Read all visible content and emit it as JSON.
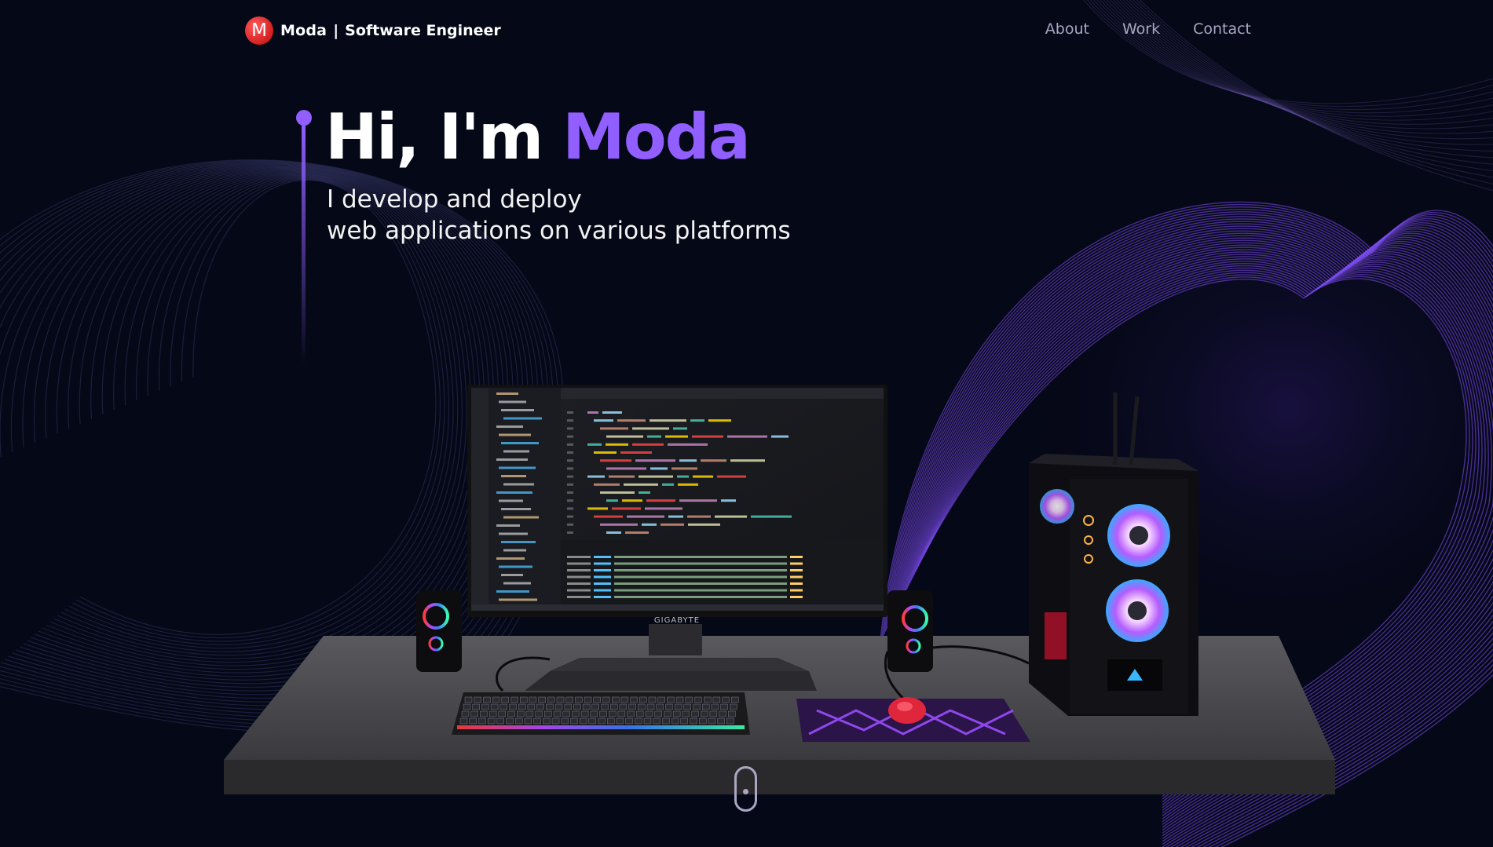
{
  "navbar": {
    "logo_letter": "M",
    "brand_name": "Moda",
    "brand_separator": "|",
    "brand_role": "Software Engineer",
    "links": [
      {
        "label": "About"
      },
      {
        "label": "Work"
      },
      {
        "label": "Contact"
      }
    ]
  },
  "hero": {
    "greeting": "Hi, I'm ",
    "name": "Moda",
    "subtitle_line1": "I develop and deploy",
    "subtitle_line2": "web applications on various platforms"
  },
  "scene": {
    "monitor_brand": "GIGABYTE"
  },
  "colors": {
    "background": "#050816",
    "accent": "#915eff",
    "nav_text": "#aaa6c3",
    "logo": "#d21f1f"
  },
  "icons": {
    "scroll": "mouse-scroll-icon"
  }
}
